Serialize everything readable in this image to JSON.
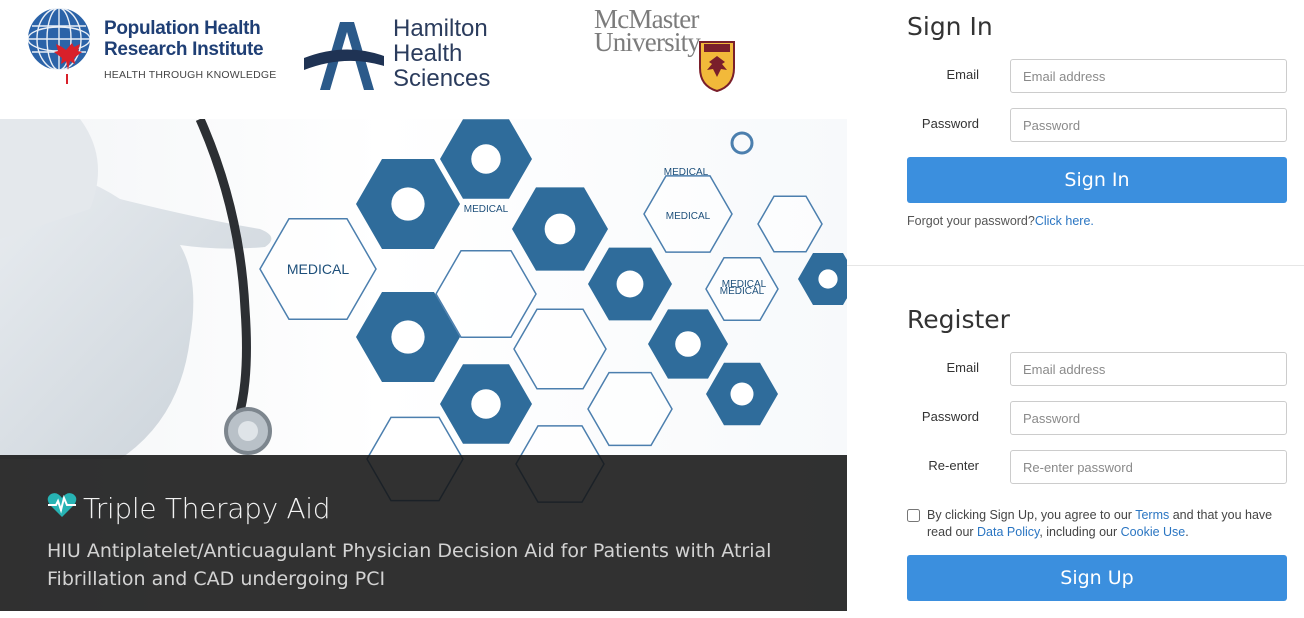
{
  "logos": {
    "phri": {
      "name": "Population Health\nResearch Institute",
      "tagline": "HEALTH THROUGH KNOWLEDGE"
    },
    "hhs": {
      "name": "Hamilton\nHealth\nSciences"
    },
    "mcmaster": {
      "name": "McMaster\nUniversity"
    }
  },
  "hero": {
    "hex_labels": [
      "MEDICAL",
      "MEDICAL",
      "MEDICAL",
      "MEDICAL",
      "MEDICAL",
      "MEDICAL"
    ],
    "app_title": "Triple Therapy Aid",
    "app_subtitle": "HIU Antiplatelet/Anticuagulant Physician Decision Aid for Patients with Atrial Fibrillation and CAD undergoing PCI",
    "icon": "heartbeat-icon"
  },
  "signin": {
    "title": "Sign In",
    "email_label": "Email",
    "email_placeholder": "Email address",
    "password_label": "Password",
    "password_placeholder": "Password",
    "button": "Sign In",
    "forgot_text": "Forgot your password?",
    "forgot_link": "Click here."
  },
  "register": {
    "title": "Register",
    "email_label": "Email",
    "email_placeholder": "Email address",
    "password_label": "Password",
    "password_placeholder": "Password",
    "reenter_label": "Re-enter",
    "reenter_placeholder": "Re-enter password",
    "agree_pre": "By clicking Sign Up, you agree to our ",
    "terms_link": "Terms",
    "agree_mid": " and that you have read our ",
    "data_policy_link": "Data Policy",
    "agree_mid2": ", including our ",
    "cookie_link": "Cookie Use",
    "agree_end": ".",
    "button": "Sign Up"
  },
  "colors": {
    "accent": "#3b8fde",
    "link": "#2a75c2",
    "hex_dark": "#1d5f92",
    "brand_navy": "#1f3f75"
  }
}
